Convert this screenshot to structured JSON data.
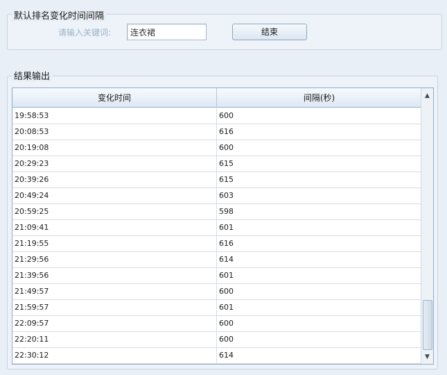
{
  "search_group": {
    "title": "默认排名变化时间间隔",
    "keyword_label": "请输入关键词:",
    "keyword_value": "连衣裙",
    "end_button": "结束"
  },
  "results_group": {
    "title": "结果输出",
    "columns": [
      "变化时间",
      "间隔(秒)"
    ],
    "rows": [
      [
        "19:58:53",
        "600"
      ],
      [
        "20:08:53",
        "616"
      ],
      [
        "20:19:08",
        "600"
      ],
      [
        "20:29:23",
        "615"
      ],
      [
        "20:39:26",
        "615"
      ],
      [
        "20:49:24",
        "603"
      ],
      [
        "20:59:25",
        "598"
      ],
      [
        "21:09:41",
        "601"
      ],
      [
        "21:19:55",
        "616"
      ],
      [
        "21:29:56",
        "614"
      ],
      [
        "21:39:56",
        "601"
      ],
      [
        "21:49:57",
        "600"
      ],
      [
        "21:59:57",
        "601"
      ],
      [
        "22:09:57",
        "600"
      ],
      [
        "22:20:11",
        "600"
      ],
      [
        "22:30:12",
        "614"
      ]
    ]
  },
  "scrollbar": {
    "up_icon": "scroll-up-arrow",
    "down_icon": "scroll-down-arrow",
    "position_fraction": 0.95
  }
}
